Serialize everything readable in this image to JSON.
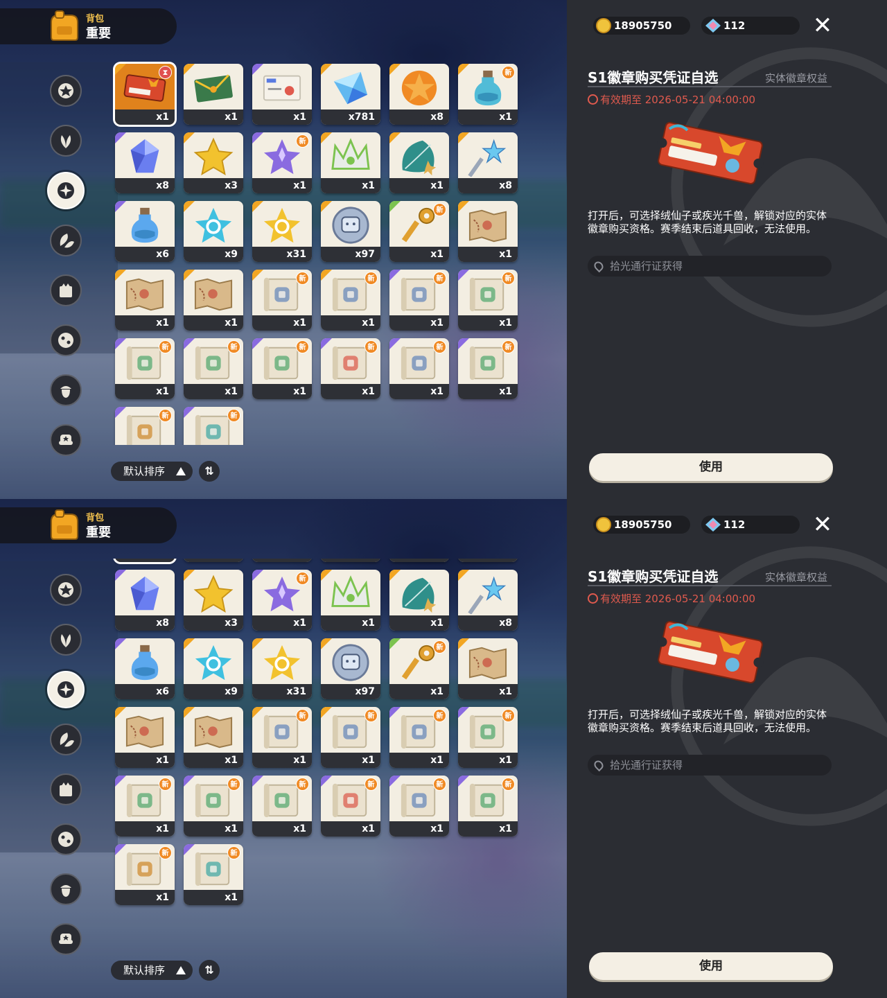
{
  "header": {
    "subtitle": "背包",
    "title": "重要"
  },
  "nav": [
    {
      "icon": "star-badge-icon"
    },
    {
      "icon": "leaf-icon"
    },
    {
      "icon": "sparkle-orb-icon",
      "active": true
    },
    {
      "icon": "leaves-icon"
    },
    {
      "icon": "crown-card-icon"
    },
    {
      "icon": "stars-ball-icon"
    },
    {
      "icon": "acorn-icon"
    },
    {
      "icon": "chair-icon"
    }
  ],
  "items": [
    {
      "name": "badge-voucher",
      "qty": "x1",
      "rarity": "orange",
      "tag": "time",
      "art": "ticket",
      "color": "#e0821c"
    },
    {
      "name": "gift-envelope",
      "qty": "x1",
      "rarity": "orange",
      "art": "envelope",
      "color": "#3a7a4a"
    },
    {
      "name": "card-ticket",
      "qty": "x1",
      "rarity": "purple",
      "art": "card",
      "color": "#f6f2ea"
    },
    {
      "name": "prism-crystal",
      "qty": "x781",
      "rarity": "orange",
      "art": "prism",
      "color": "#62b8f0"
    },
    {
      "name": "orange-star-coin",
      "qty": "x8",
      "rarity": "orange",
      "art": "coin",
      "color": "#f08a24"
    },
    {
      "name": "potion-bottle",
      "qty": "x1",
      "rarity": "orange",
      "tag": "new",
      "art": "bottle",
      "color": "#3fb6d6"
    },
    {
      "name": "blue-crystal",
      "qty": "x8",
      "rarity": "purple",
      "art": "crystal",
      "color": "#6a7ef0"
    },
    {
      "name": "gold-star",
      "qty": "x3",
      "rarity": "orange",
      "art": "star",
      "color": "#f2c22e"
    },
    {
      "name": "purple-star-gem",
      "qty": "x1",
      "rarity": "purple",
      "tag": "new",
      "art": "stargem",
      "color": "#8a6be0"
    },
    {
      "name": "crown-gem",
      "qty": "x1",
      "rarity": "orange",
      "art": "crown",
      "color": "#7cc34f"
    },
    {
      "name": "teal-leaf",
      "qty": "x1",
      "rarity": "orange",
      "art": "leaf",
      "color": "#2f8f8a"
    },
    {
      "name": "star-wand",
      "qty": "x8",
      "rarity": "orange",
      "art": "wand",
      "color": "#9aa6b8"
    },
    {
      "name": "blue-potion",
      "qty": "x6",
      "rarity": "purple",
      "art": "bottle",
      "color": "#4aa0f0"
    },
    {
      "name": "cyan-star",
      "qty": "x9",
      "rarity": "orange",
      "art": "cstar",
      "color": "#3fc0e0"
    },
    {
      "name": "yellow-star-coin",
      "qty": "x31",
      "rarity": "orange",
      "art": "cstar",
      "color": "#f2c22e"
    },
    {
      "name": "silver-coin",
      "qty": "x97",
      "rarity": "orange",
      "art": "silver",
      "color": "#a8b8d0"
    },
    {
      "name": "golden-key",
      "qty": "x1",
      "rarity": "green",
      "tag": "new",
      "art": "key",
      "color": "#e0a030"
    },
    {
      "name": "treasure-map",
      "qty": "x1",
      "rarity": "orange",
      "art": "map",
      "color": "#d9b98a"
    },
    {
      "name": "treasure-map",
      "qty": "x1",
      "rarity": "orange",
      "art": "map",
      "color": "#d9b98a"
    },
    {
      "name": "treasure-map",
      "qty": "x1",
      "rarity": "orange",
      "art": "map",
      "color": "#d9b98a"
    },
    {
      "name": "scroll-blue",
      "qty": "x1",
      "rarity": "orange",
      "tag": "new",
      "art": "scroll",
      "color": "#8aa0c0"
    },
    {
      "name": "scroll-blue",
      "qty": "x1",
      "rarity": "orange",
      "tag": "new",
      "art": "scroll",
      "color": "#8aa0c0"
    },
    {
      "name": "scroll-blue",
      "qty": "x1",
      "rarity": "purple",
      "tag": "new",
      "art": "scroll",
      "color": "#8aa0c0"
    },
    {
      "name": "scroll-green",
      "qty": "x1",
      "rarity": "purple",
      "tag": "new",
      "art": "scroll",
      "color": "#7cb889"
    },
    {
      "name": "scroll-green",
      "qty": "x1",
      "rarity": "purple",
      "tag": "new",
      "art": "scroll",
      "color": "#7cb889"
    },
    {
      "name": "scroll-green",
      "qty": "x1",
      "rarity": "purple",
      "tag": "new",
      "art": "scroll",
      "color": "#7cb889"
    },
    {
      "name": "scroll-green",
      "qty": "x1",
      "rarity": "purple",
      "tag": "new",
      "art": "scroll",
      "color": "#7cb889"
    },
    {
      "name": "scroll-red",
      "qty": "x1",
      "rarity": "purple",
      "tag": "new",
      "art": "scroll",
      "color": "#e08070"
    },
    {
      "name": "scroll-blue",
      "qty": "x1",
      "rarity": "purple",
      "tag": "new",
      "art": "scroll",
      "color": "#8aa0c0"
    },
    {
      "name": "scroll-green",
      "qty": "x1",
      "rarity": "purple",
      "tag": "new",
      "art": "scroll",
      "color": "#7cb889"
    },
    {
      "name": "scroll-orange",
      "qty": "x1",
      "rarity": "purple",
      "tag": "new",
      "art": "scroll",
      "color": "#d6a25a"
    },
    {
      "name": "scroll-teal",
      "qty": "x1",
      "rarity": "purple",
      "tag": "new",
      "art": "scroll",
      "color": "#6fb8b0"
    }
  ],
  "new_tag": "新",
  "sort": {
    "label": "默认排序",
    "toggle": "⇅"
  },
  "currency": {
    "coins": "18905750",
    "gems": "112"
  },
  "close_glyph": "✕",
  "detail": {
    "name": "S1徽章购买凭证自选",
    "category": "实体徽章权益",
    "expire": "有效期至 2026-05-21 04:00:00",
    "description": "打开后，可选择绒仙子或疾光千兽，解锁对应的实体徽章购买资格。赛季结束后道具回收，无法使用。",
    "source": "拾光通行证获得",
    "use_label": "使用"
  }
}
